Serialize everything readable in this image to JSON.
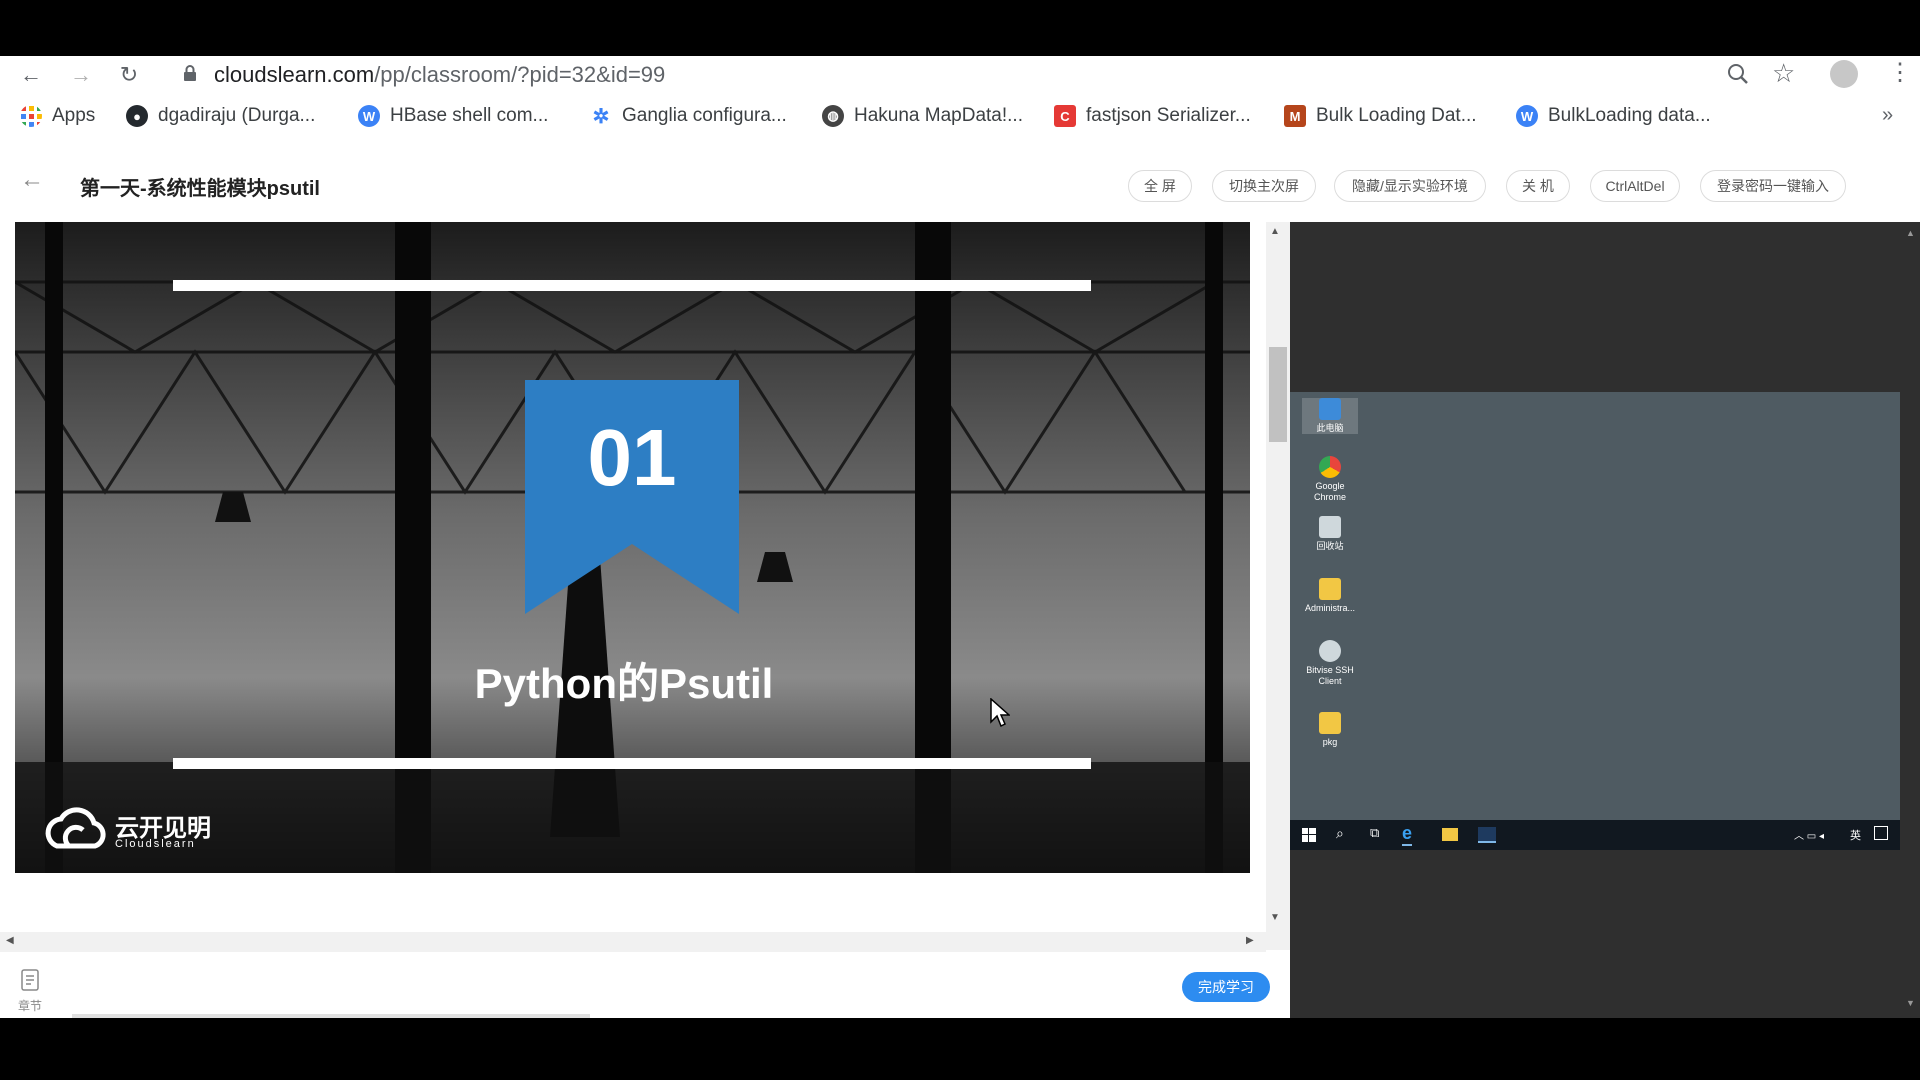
{
  "browser": {
    "url_host": "cloudslearn.com",
    "url_path": "/pp/classroom/?pid=32&id=99",
    "bookmarks": [
      {
        "label": "Apps",
        "icon": "apps-grid-icon",
        "color": "#ea4335"
      },
      {
        "label": "dgadiraju (Durga...",
        "icon": "github-icon",
        "color": "#24292e"
      },
      {
        "label": "HBase shell com...",
        "icon": "wordpress-icon",
        "color": "#3b82f6"
      },
      {
        "label": "Ganglia configura...",
        "icon": "ganglia-icon",
        "color": "#3b82f6"
      },
      {
        "label": "Hakuna MapData!...",
        "icon": "globe-icon",
        "color": "#444444"
      },
      {
        "label": "fastjson Serializer...",
        "icon": "c-logo-icon",
        "color": "#e53935"
      },
      {
        "label": "Bulk Loading Dat...",
        "icon": "m-logo-icon",
        "color": "#b5451b"
      },
      {
        "label": "BulkLoading data...",
        "icon": "wordpress-icon",
        "color": "#3b82f6"
      }
    ],
    "overflow": "»"
  },
  "header": {
    "title": "第一天-系统性能模块psutil",
    "buttons": [
      "全 屏",
      "切换主次屏",
      "隐藏/显示实验环境",
      "关 机",
      "CtrlAltDel",
      "登录密码一键输入"
    ]
  },
  "slide": {
    "number": "01",
    "heading": "Python的Psutil",
    "logo_cn": "云开见明",
    "logo_en": "Cloudslearn",
    "accent_color": "#2d7ec4"
  },
  "bottom": {
    "chapter_label": "章节",
    "complete_button": "完成学习",
    "complete_color": "#2d8cf0"
  },
  "desktop": {
    "icons": [
      {
        "label": "此电脑",
        "color": "#3d8bd9"
      },
      {
        "label": "Google Chrome",
        "color": "#e8453c"
      },
      {
        "label": "回收站",
        "color": "#cfd8dc"
      },
      {
        "label": "Administra...",
        "color": "#f2c744"
      },
      {
        "label": "Bitvise SSH Client",
        "color": "#cfd8dc"
      },
      {
        "label": "pkg",
        "color": "#f2c744"
      }
    ],
    "tray_lang": "英"
  }
}
